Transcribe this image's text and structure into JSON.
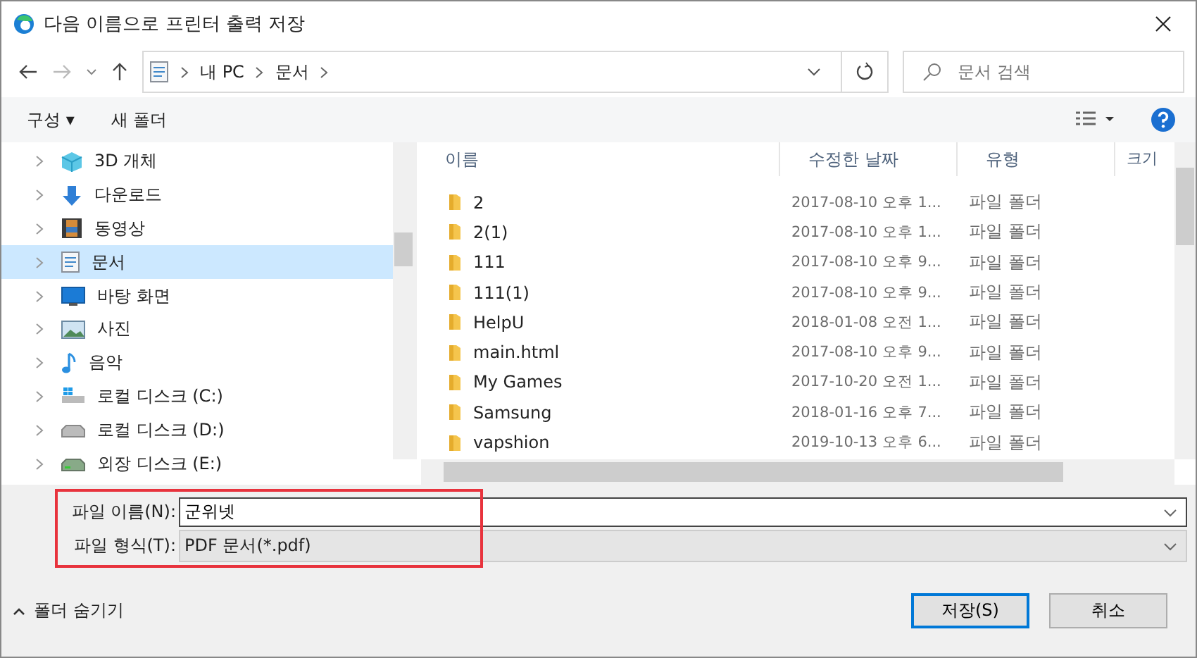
{
  "window": {
    "title": "다음 이름으로 프린터 출력 저장"
  },
  "address": {
    "crumbs": [
      "내 PC",
      "문서"
    ]
  },
  "search": {
    "placeholder": "문서 검색"
  },
  "toolbar": {
    "organize": "구성 ▾",
    "new_folder": "새 폴더"
  },
  "sidebar": {
    "items": [
      {
        "label": "3D 개체",
        "selected": false
      },
      {
        "label": "다운로드",
        "selected": false
      },
      {
        "label": "동영상",
        "selected": false
      },
      {
        "label": "문서",
        "selected": true
      },
      {
        "label": "바탕 화면",
        "selected": false
      },
      {
        "label": "사진",
        "selected": false
      },
      {
        "label": "음악",
        "selected": false
      },
      {
        "label": "로컬 디스크 (C:)",
        "selected": false
      },
      {
        "label": "로컬 디스크 (D:)",
        "selected": false
      },
      {
        "label": "외장 디스크 (E:)",
        "selected": false
      }
    ]
  },
  "table": {
    "columns": [
      "이름",
      "수정한 날짜",
      "유형",
      "크기"
    ],
    "rows": [
      {
        "name": "2",
        "date": "2017-08-10 오후 1...",
        "type": "파일 폴더"
      },
      {
        "name": "2(1)",
        "date": "2017-08-10 오후 1...",
        "type": "파일 폴더"
      },
      {
        "name": "111",
        "date": "2017-08-10 오후 9...",
        "type": "파일 폴더"
      },
      {
        "name": "111(1)",
        "date": "2017-08-10 오후 9...",
        "type": "파일 폴더"
      },
      {
        "name": "HelpU",
        "date": "2018-01-08 오전 1...",
        "type": "파일 폴더"
      },
      {
        "name": "main.html",
        "date": "2017-08-10 오후 9...",
        "type": "파일 폴더"
      },
      {
        "name": "My Games",
        "date": "2017-10-20 오전 1...",
        "type": "파일 폴더"
      },
      {
        "name": "Samsung",
        "date": "2018-01-16 오후 7...",
        "type": "파일 폴더"
      },
      {
        "name": "vapshion",
        "date": "2019-10-13 오후 6...",
        "type": "파일 폴더"
      }
    ]
  },
  "form": {
    "filename_label": "파일 이름(N):",
    "filename": "군위넷",
    "filetype_label": "파일 형식(T):",
    "filetype": "PDF 문서(*.pdf)"
  },
  "hide_folders": "폴더 숨기기",
  "buttons": [
    {
      "label": "저장(S)",
      "default": true
    },
    {
      "label": "취소",
      "default": false
    }
  ]
}
